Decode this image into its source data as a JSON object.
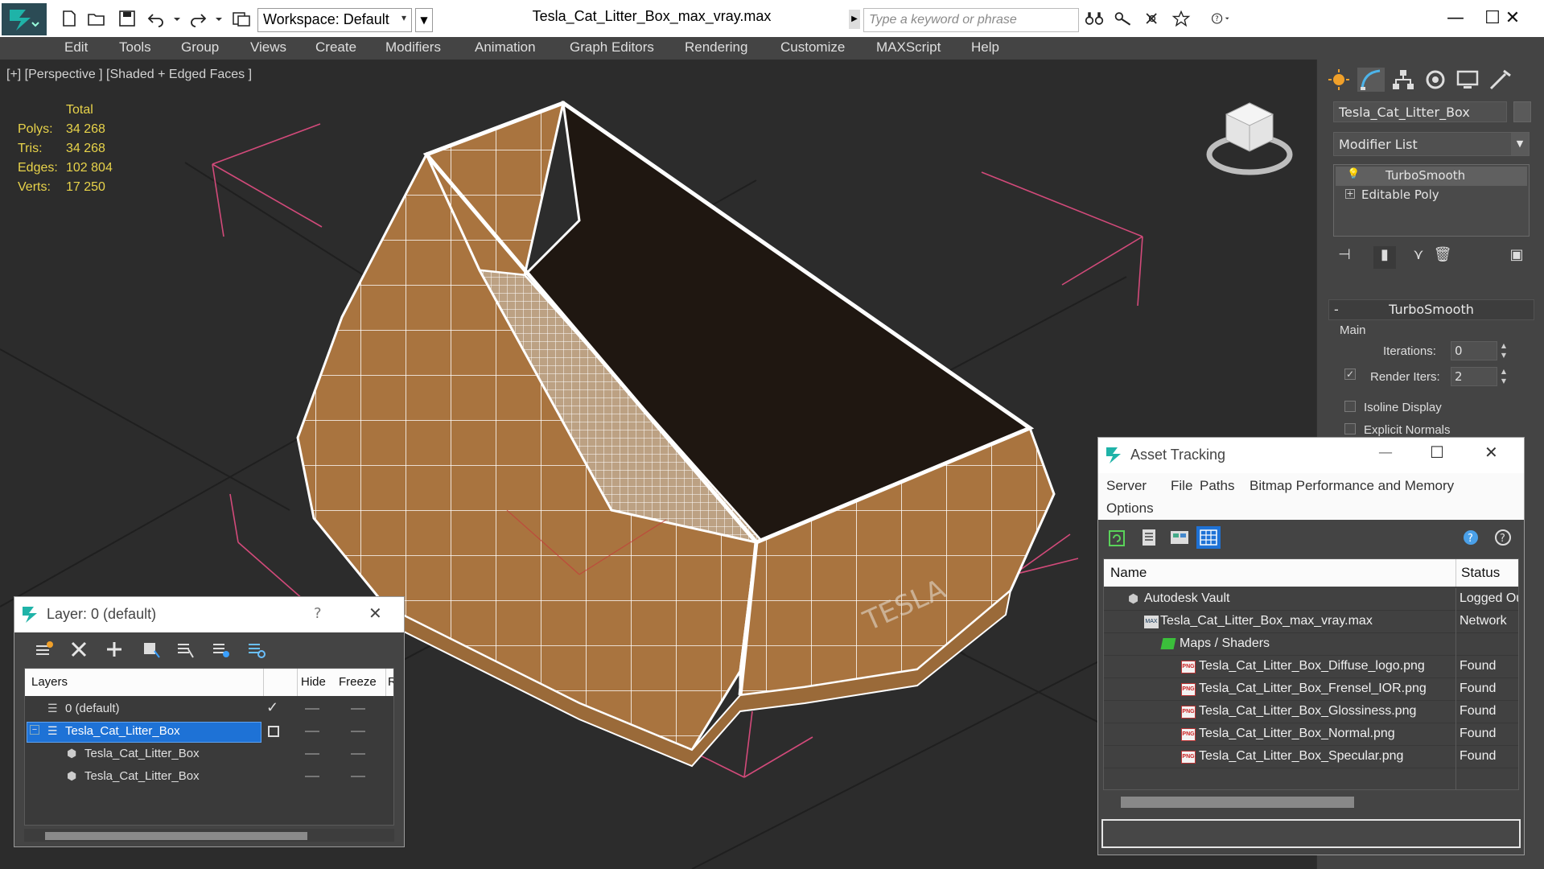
{
  "titlebar": {
    "workspace_label": "Workspace: Default",
    "title": "Tesla_Cat_Litter_Box_max_vray.max",
    "search_placeholder": "Type a keyword or phrase",
    "minimize": "—",
    "maximize": "☐",
    "close": "✕"
  },
  "menu": [
    "Edit",
    "Tools",
    "Group",
    "Views",
    "Create",
    "Modifiers",
    "Animation",
    "Graph Editors",
    "Rendering",
    "Customize",
    "MAXScript",
    "Help"
  ],
  "viewport": {
    "label": "[+] [Perspective ] [Shaded + Edged Faces ]",
    "stats": {
      "header": "Total",
      "polys_label": "Polys:",
      "polys": "34 268",
      "tris_label": "Tris:",
      "tris": "34 268",
      "edges_label": "Edges:",
      "edges": "102 804",
      "verts_label": "Verts:",
      "verts": "17 250"
    },
    "logo_text": "TESLA"
  },
  "command_panel": {
    "object_name": "Tesla_Cat_Litter_Box",
    "modifier_list": "Modifier List",
    "stack": [
      "TurboSmooth",
      "Editable Poly"
    ],
    "rollout": {
      "title": "TurboSmooth",
      "group": "Main",
      "iterations_label": "Iterations:",
      "iterations": "0",
      "render_iters_label": "Render Iters:",
      "render_iters": "2",
      "isoline_label": "Isoline Display",
      "explicit_label": "Explicit Normals"
    }
  },
  "layer_window": {
    "title": "Layer: 0 (default)",
    "help": "?",
    "close": "✕",
    "columns": [
      "Layers",
      "Hide",
      "Freeze",
      "R"
    ],
    "rows": [
      {
        "name": "0 (default)"
      },
      {
        "name": "Tesla_Cat_Litter_Box"
      },
      {
        "name": "Tesla_Cat_Litter_Box"
      },
      {
        "name": "Tesla_Cat_Litter_Box"
      }
    ]
  },
  "asset_window": {
    "title": "Asset Tracking",
    "minimize": "—",
    "maximize": "☐",
    "close": "✕",
    "menu": [
      "Server",
      "File",
      "Paths",
      "Bitmap Performance and Memory",
      "Options"
    ],
    "columns": [
      "Name",
      "Status"
    ],
    "rows": [
      {
        "name": "Autodesk Vault",
        "status": "Logged Out"
      },
      {
        "name": "Tesla_Cat_Litter_Box_max_vray.max",
        "status": "Network"
      },
      {
        "name": "Maps / Shaders",
        "status": ""
      },
      {
        "name": "Tesla_Cat_Litter_Box_Diffuse_logo.png",
        "status": "Found"
      },
      {
        "name": "Tesla_Cat_Litter_Box_Frensel_IOR.png",
        "status": "Found"
      },
      {
        "name": "Tesla_Cat_Litter_Box_Glossiness.png",
        "status": "Found"
      },
      {
        "name": "Tesla_Cat_Litter_Box_Normal.png",
        "status": "Found"
      },
      {
        "name": "Tesla_Cat_Litter_Box_Specular.png",
        "status": "Found"
      }
    ],
    "png_badge": "PNG"
  }
}
